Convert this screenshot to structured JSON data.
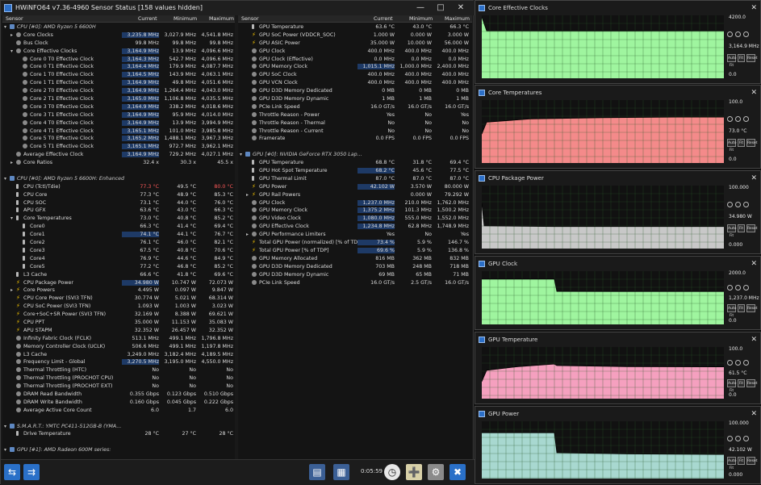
{
  "window": {
    "title": "HWiNFO64 v7.36-4960 Sensor Status [158 values hidden]"
  },
  "columns": {
    "sensor": "Sensor",
    "current": "Current",
    "minimum": "Minimum",
    "maximum": "Maximum"
  },
  "left_rows": [
    {
      "g": true,
      "n": "CPU [#0]: AMD Ryzen 5 6600H",
      "i": "chip",
      "ind": 0,
      "ar": "v"
    },
    {
      "n": "Core Clocks",
      "c": "3,235.8 MHz",
      "mn": "3,027.9 MHz",
      "mx": "4,541.8 MHz",
      "i": "circle",
      "ind": 1,
      "ar": ">",
      "hl": true
    },
    {
      "n": "Bus Clock",
      "c": "99.8 MHz",
      "mn": "99.8 MHz",
      "mx": "99.8 MHz",
      "i": "circle",
      "ind": 1
    },
    {
      "n": "Core Effective Clocks",
      "c": "3,164.9 MHz",
      "mn": "13.9 MHz",
      "mx": "4,096.6 MHz",
      "i": "circle",
      "ind": 1,
      "ar": "v",
      "hl": true
    },
    {
      "n": "Core 0 T0 Effective Clock",
      "c": "3,164.3 MHz",
      "mn": "542.7 MHz",
      "mx": "4,096.6 MHz",
      "i": "circle",
      "ind": 2,
      "hl": true
    },
    {
      "n": "Core 0 T1 Effective Clock",
      "c": "3,164.4 MHz",
      "mn": "179.9 MHz",
      "mx": "4,087.7 MHz",
      "i": "circle",
      "ind": 2,
      "hl": true
    },
    {
      "n": "Core 1 T0 Effective Clock",
      "c": "3,164.5 MHz",
      "mn": "143.9 MHz",
      "mx": "4,063.1 MHz",
      "i": "circle",
      "ind": 2,
      "hl": true
    },
    {
      "n": "Core 1 T1 Effective Clock",
      "c": "3,164.9 MHz",
      "mn": "49.8 MHz",
      "mx": "4,051.6 MHz",
      "i": "circle",
      "ind": 2,
      "hl": true
    },
    {
      "n": "Core 2 T0 Effective Clock",
      "c": "3,164.9 MHz",
      "mn": "1,264.4 MHz",
      "mx": "4,043.0 MHz",
      "i": "circle",
      "ind": 2,
      "hl": true
    },
    {
      "n": "Core 2 T1 Effective Clock",
      "c": "3,165.0 MHz",
      "mn": "1,106.8 MHz",
      "mx": "4,035.5 MHz",
      "i": "circle",
      "ind": 2,
      "hl": true
    },
    {
      "n": "Core 3 T0 Effective Clock",
      "c": "3,164.9 MHz",
      "mn": "338.2 MHz",
      "mx": "4,018.6 MHz",
      "i": "circle",
      "ind": 2,
      "hl": true
    },
    {
      "n": "Core 3 T1 Effective Clock",
      "c": "3,164.9 MHz",
      "mn": "95.9 MHz",
      "mx": "4,014.0 MHz",
      "i": "circle",
      "ind": 2,
      "hl": true
    },
    {
      "n": "Core 4 T0 Effective Clock",
      "c": "3,164.9 MHz",
      "mn": "13.9 MHz",
      "mx": "3,994.9 MHz",
      "i": "circle",
      "ind": 2,
      "hl": true
    },
    {
      "n": "Core 4 T1 Effective Clock",
      "c": "3,165.1 MHz",
      "mn": "101.0 MHz",
      "mx": "3,985.8 MHz",
      "i": "circle",
      "ind": 2,
      "hl": true
    },
    {
      "n": "Core 5 T0 Effective Clock",
      "c": "3,165.2 MHz",
      "mn": "1,488.1 MHz",
      "mx": "3,967.3 MHz",
      "i": "circle",
      "ind": 2,
      "hl": true
    },
    {
      "n": "Core 5 T1 Effective Clock",
      "c": "3,165.1 MHz",
      "mn": "972.7 MHz",
      "mx": "3,962.1 MHz",
      "i": "circle",
      "ind": 2,
      "hl": true
    },
    {
      "n": "Average Effective Clock",
      "c": "3,164.9 MHz",
      "mn": "729.2 MHz",
      "mx": "4,027.1 MHz",
      "i": "circle",
      "ind": 1,
      "hl": true
    },
    {
      "n": "Core Ratios",
      "c": "32.4 x",
      "mn": "30.3 x",
      "mx": "45.5 x",
      "i": "circle",
      "ind": 1,
      "ar": ">"
    },
    {
      "sp": true
    },
    {
      "g": true,
      "n": "CPU [#0]: AMD Ryzen 5 6600H: Enhanced",
      "i": "chip",
      "ind": 0,
      "ar": "v"
    },
    {
      "n": "CPU (Tctl/Tdie)",
      "c": "77.3 °C",
      "mn": "49.5 °C",
      "mx": "80.0 °C",
      "i": "therm",
      "ind": 1,
      "red": true
    },
    {
      "n": "CPU Core",
      "c": "77.3 °C",
      "mn": "48.9 °C",
      "mx": "85.3 °C",
      "i": "therm",
      "ind": 1
    },
    {
      "n": "CPU SOC",
      "c": "73.1 °C",
      "mn": "44.0 °C",
      "mx": "76.0 °C",
      "i": "therm",
      "ind": 1
    },
    {
      "n": "APU GFX",
      "c": "63.6 °C",
      "mn": "43.0 °C",
      "mx": "66.3 °C",
      "i": "therm",
      "ind": 1
    },
    {
      "n": "Core Temperatures",
      "c": "73.0 °C",
      "mn": "40.8 °C",
      "mx": "85.2 °C",
      "i": "therm",
      "ind": 1,
      "ar": "v"
    },
    {
      "n": "Core0",
      "c": "66.3 °C",
      "mn": "41.4 °C",
      "mx": "69.4 °C",
      "i": "therm",
      "ind": 2
    },
    {
      "n": "Core1",
      "c": "74.1 °C",
      "mn": "44.1 °C",
      "mx": "76.7 °C",
      "i": "therm",
      "ind": 2,
      "hl": true
    },
    {
      "n": "Core2",
      "c": "76.1 °C",
      "mn": "46.0 °C",
      "mx": "82.1 °C",
      "i": "therm",
      "ind": 2
    },
    {
      "n": "Core3",
      "c": "67.5 °C",
      "mn": "40.8 °C",
      "mx": "70.6 °C",
      "i": "therm",
      "ind": 2
    },
    {
      "n": "Core4",
      "c": "76.9 °C",
      "mn": "44.6 °C",
      "mx": "84.9 °C",
      "i": "therm",
      "ind": 2
    },
    {
      "n": "Core5",
      "c": "77.2 °C",
      "mn": "46.8 °C",
      "mx": "85.2 °C",
      "i": "therm",
      "ind": 2
    },
    {
      "n": "L3 Cache",
      "c": "66.6 °C",
      "mn": "41.8 °C",
      "mx": "69.6 °C",
      "i": "therm",
      "ind": 1
    },
    {
      "n": "CPU Package Power",
      "c": "34.980 W",
      "mn": "10.747 W",
      "mx": "72.073 W",
      "i": "bolt",
      "ind": 1,
      "hl": true
    },
    {
      "n": "Core Powers",
      "c": "4.495 W",
      "mn": "0.097 W",
      "mx": "9.847 W",
      "i": "bolt",
      "ind": 1,
      "ar": ">"
    },
    {
      "n": "CPU Core Power (SVI3 TFN)",
      "c": "30.774 W",
      "mn": "5.021 W",
      "mx": "68.314 W",
      "i": "bolt",
      "ind": 1
    },
    {
      "n": "CPU SoC Power (SVI3 TFN)",
      "c": "1.093 W",
      "mn": "1.003 W",
      "mx": "3.023 W",
      "i": "bolt",
      "ind": 1
    },
    {
      "n": "Core+SoC+SR Power (SVI3 TFN)",
      "c": "32.169 W",
      "mn": "8.388 W",
      "mx": "69.621 W",
      "i": "bolt",
      "ind": 1
    },
    {
      "n": "CPU PPT",
      "c": "35.000 W",
      "mn": "11.153 W",
      "mx": "35.083 W",
      "i": "bolt",
      "ind": 1
    },
    {
      "n": "APU STAPM",
      "c": "32.352 W",
      "mn": "26.457 W",
      "mx": "32.352 W",
      "i": "bolt",
      "ind": 1
    },
    {
      "n": "Infinity Fabric Clock (FCLK)",
      "c": "513.1 MHz",
      "mn": "499.1 MHz",
      "mx": "1,796.8 MHz",
      "i": "circle",
      "ind": 1
    },
    {
      "n": "Memory Controller Clock (UCLK)",
      "c": "506.6 MHz",
      "mn": "499.1 MHz",
      "mx": "1,197.8 MHz",
      "i": "circle",
      "ind": 1
    },
    {
      "n": "L3 Cache",
      "c": "3,249.0 MHz",
      "mn": "3,182.4 MHz",
      "mx": "4,189.5 MHz",
      "i": "circle",
      "ind": 1
    },
    {
      "n": "Frequency Limit - Global",
      "c": "3,270.5 MHz",
      "mn": "3,195.0 MHz",
      "mx": "4,550.0 MHz",
      "i": "circle",
      "ind": 1,
      "hl": true
    },
    {
      "n": "Thermal Throttling (HTC)",
      "c": "No",
      "mn": "No",
      "mx": "No",
      "i": "circle",
      "ind": 1
    },
    {
      "n": "Thermal Throttling (PROCHOT CPU)",
      "c": "No",
      "mn": "No",
      "mx": "No",
      "i": "circle",
      "ind": 1
    },
    {
      "n": "Thermal Throttling (PROCHOT EXT)",
      "c": "No",
      "mn": "No",
      "mx": "No",
      "i": "circle",
      "ind": 1
    },
    {
      "n": "DRAM Read Bandwidth",
      "c": "0.355 Gbps",
      "mn": "0.123 Gbps",
      "mx": "0.510 Gbps",
      "i": "circle",
      "ind": 1
    },
    {
      "n": "DRAM Write Bandwidth",
      "c": "0.160 Gbps",
      "mn": "0.045 Gbps",
      "mx": "0.222 Gbps",
      "i": "circle",
      "ind": 1
    },
    {
      "n": "Average Active Core Count",
      "c": "6.0",
      "mn": "1.7",
      "mx": "6.0",
      "i": "circle",
      "ind": 1
    },
    {
      "sp": true
    },
    {
      "g": true,
      "n": "S.M.A.R.T.: YMTC PC411-512GB-B (YMA...",
      "i": "chip",
      "ind": 0,
      "ar": "v"
    },
    {
      "n": "Drive Temperature",
      "c": "28 °C",
      "mn": "27 °C",
      "mx": "28 °C",
      "i": "therm",
      "ind": 1
    },
    {
      "sp": true
    },
    {
      "g": true,
      "n": "GPU [#1]: AMD Radeon 600M series:",
      "i": "chip",
      "ind": 0,
      "ar": "v"
    }
  ],
  "right_rows": [
    {
      "n": "GPU Temperature",
      "c": "63.6 °C",
      "mn": "43.0 °C",
      "mx": "66.3 °C",
      "i": "therm",
      "ind": 1
    },
    {
      "n": "GPU SoC Power (VDDCR_SOC)",
      "c": "1.000 W",
      "mn": "0.000 W",
      "mx": "3.000 W",
      "i": "bolt",
      "ind": 1
    },
    {
      "n": "GPU ASIC Power",
      "c": "35.000 W",
      "mn": "10.000 W",
      "mx": "56.000 W",
      "i": "bolt",
      "ind": 1
    },
    {
      "n": "GPU Clock",
      "c": "400.0 MHz",
      "mn": "400.0 MHz",
      "mx": "400.0 MHz",
      "i": "circle",
      "ind": 1
    },
    {
      "n": "GPU Clock (Effective)",
      "c": "0.0 MHz",
      "mn": "0.0 MHz",
      "mx": "0.0 MHz",
      "i": "circle",
      "ind": 1
    },
    {
      "n": "GPU Memory Clock",
      "c": "1,015.1 MHz",
      "mn": "1,000.0 MHz",
      "mx": "2,400.0 MHz",
      "i": "circle",
      "ind": 1,
      "hl": true
    },
    {
      "n": "GPU SoC Clock",
      "c": "400.0 MHz",
      "mn": "400.0 MHz",
      "mx": "400.0 MHz",
      "i": "circle",
      "ind": 1
    },
    {
      "n": "GPU VCN Clock",
      "c": "400.0 MHz",
      "mn": "400.0 MHz",
      "mx": "400.0 MHz",
      "i": "circle",
      "ind": 1
    },
    {
      "n": "GPU D3D Memory Dedicated",
      "c": "0 MB",
      "mn": "0 MB",
      "mx": "0 MB",
      "i": "circle",
      "ind": 1
    },
    {
      "n": "GPU D3D Memory Dynamic",
      "c": "1 MB",
      "mn": "1 MB",
      "mx": "1 MB",
      "i": "circle",
      "ind": 1
    },
    {
      "n": "PCIe Link Speed",
      "c": "16.0 GT/s",
      "mn": "16.0 GT/s",
      "mx": "16.0 GT/s",
      "i": "circle",
      "ind": 1
    },
    {
      "n": "Throttle Reason - Power",
      "c": "Yes",
      "mn": "No",
      "mx": "Yes",
      "i": "circle",
      "ind": 1
    },
    {
      "n": "Throttle Reason - Thermal",
      "c": "No",
      "mn": "No",
      "mx": "No",
      "i": "circle",
      "ind": 1
    },
    {
      "n": "Throttle Reason - Current",
      "c": "No",
      "mn": "No",
      "mx": "No",
      "i": "circle",
      "ind": 1
    },
    {
      "n": "Framerate",
      "c": "0.0 FPS",
      "mn": "0.0 FPS",
      "mx": "0.0 FPS",
      "i": "circle",
      "ind": 1
    },
    {
      "sp": true
    },
    {
      "g": true,
      "n": "GPU [#0]: NVIDIA GeForce RTX 3050 Lap...",
      "i": "chip",
      "ind": 0,
      "ar": "v"
    },
    {
      "n": "GPU Temperature",
      "c": "68.8 °C",
      "mn": "31.8 °C",
      "mx": "69.4 °C",
      "i": "therm",
      "ind": 1
    },
    {
      "n": "GPU Hot Spot Temperature",
      "c": "68.2 °C",
      "mn": "45.6 °C",
      "mx": "77.5 °C",
      "i": "therm",
      "ind": 1,
      "hl": true
    },
    {
      "n": "GPU Thermal Limit",
      "c": "87.0 °C",
      "mn": "87.0 °C",
      "mx": "87.0 °C",
      "i": "therm",
      "ind": 1
    },
    {
      "n": "GPU Power",
      "c": "42.102 W",
      "mn": "3.570 W",
      "mx": "80.000 W",
      "i": "bolt",
      "ind": 1,
      "hl": true
    },
    {
      "n": "GPU Rail Powers",
      "c": "",
      "mn": "0.000 W",
      "mx": "79.292 W",
      "i": "bolt",
      "ind": 1,
      "ar": ">"
    },
    {
      "n": "GPU Clock",
      "c": "1,237.0 MHz",
      "mn": "210.0 MHz",
      "mx": "1,762.0 MHz",
      "i": "circle",
      "ind": 1,
      "hl": true
    },
    {
      "n": "GPU Memory Clock",
      "c": "1,375.2 MHz",
      "mn": "101.3 MHz",
      "mx": "1,500.2 MHz",
      "i": "circle",
      "ind": 1,
      "hl": true
    },
    {
      "n": "GPU Video Clock",
      "c": "1,080.0 MHz",
      "mn": "555.0 MHz",
      "mx": "1,552.0 MHz",
      "i": "circle",
      "ind": 1,
      "hl": true
    },
    {
      "n": "GPU Effective Clock",
      "c": "1,234.8 MHz",
      "mn": "62.8 MHz",
      "mx": "1,748.9 MHz",
      "i": "circle",
      "ind": 1,
      "hl": true
    },
    {
      "n": "GPU Performance Limiters",
      "c": "Yes",
      "mn": "No",
      "mx": "Yes",
      "i": "circle",
      "ind": 1,
      "ar": ">"
    },
    {
      "n": "Total GPU Power (normalized) [% of TDP]",
      "c": "73.4 %",
      "mn": "5.9 %",
      "mx": "146.7 %",
      "i": "bolt",
      "ind": 1,
      "hl": true
    },
    {
      "n": "Total GPU Power [% of TDP]",
      "c": "69.6 %",
      "mn": "5.9 %",
      "mx": "136.8 %",
      "i": "bolt",
      "ind": 1,
      "hl": true
    },
    {
      "n": "GPU Memory Allocated",
      "c": "816 MB",
      "mn": "362 MB",
      "mx": "832 MB",
      "i": "circle",
      "ind": 1
    },
    {
      "n": "GPU D3D Memory Dedicated",
      "c": "703 MB",
      "mn": "248 MB",
      "mx": "718 MB",
      "i": "circle",
      "ind": 1
    },
    {
      "n": "GPU D3D Memory Dynamic",
      "c": "69 MB",
      "mn": "65 MB",
      "mx": "71 MB",
      "i": "circle",
      "ind": 1
    },
    {
      "n": "PCIe Link Speed",
      "c": "16.0 GT/s",
      "mn": "2.5 GT/s",
      "mx": "16.0 GT/s",
      "i": "circle",
      "ind": 1
    }
  ],
  "footer": {
    "timer": "0:05:59"
  },
  "graph_buttons": {
    "auto_fit": "Auto Fit",
    "reset": "Reset"
  },
  "graphs": [
    {
      "title": "Core Effective Clocks",
      "max_label": "4200.0",
      "cur_label": "3,164.9 MHz",
      "min_label": "0.0",
      "color": "#9ff59f",
      "vmax": 4200,
      "chart_data": {
        "type": "area",
        "y_range": [
          0,
          4200
        ],
        "points": [
          [
            0,
            4100
          ],
          [
            0.02,
            3164
          ],
          [
            0.5,
            3160
          ],
          [
            1,
            3164.9
          ]
        ]
      }
    },
    {
      "title": "Core Temperatures",
      "max_label": "100.0",
      "cur_label": "73.0 °C",
      "min_label": "0.0",
      "color": "#f48a8a",
      "vmax": 100,
      "chart_data": {
        "type": "area",
        "y_range": [
          0,
          100
        ],
        "points": [
          [
            0,
            46
          ],
          [
            0.02,
            65
          ],
          [
            0.2,
            70
          ],
          [
            0.5,
            72
          ],
          [
            0.8,
            73
          ],
          [
            1,
            73
          ]
        ]
      }
    },
    {
      "title": "CPU Package Power",
      "max_label": "100.000",
      "cur_label": "34.980 W",
      "min_label": "0.000",
      "color": "#c8c8c8",
      "vmax": 100,
      "chart_data": {
        "type": "area",
        "y_range": [
          0,
          100
        ],
        "points": [
          [
            0,
            72
          ],
          [
            0.01,
            36
          ],
          [
            0.3,
            35
          ],
          [
            0.7,
            35
          ],
          [
            1,
            34.98
          ]
        ]
      }
    },
    {
      "title": "GPU Clock",
      "max_label": "2000.0",
      "cur_label": "1,237.0 MHz",
      "min_label": "0.0",
      "color": "#9ff59f",
      "vmax": 2000,
      "chart_data": {
        "type": "area",
        "y_range": [
          0,
          2000
        ],
        "points": [
          [
            0,
            1700
          ],
          [
            0.3,
            1700
          ],
          [
            0.31,
            1240
          ],
          [
            0.6,
            1237
          ],
          [
            1,
            1237
          ]
        ]
      }
    },
    {
      "title": "GPU Temperature",
      "max_label": "100.0",
      "cur_label": "61.5 °C",
      "min_label": "0.0",
      "color": "#f5a0bf",
      "vmax": 100,
      "chart_data": {
        "type": "area",
        "y_range": [
          0,
          100
        ],
        "points": [
          [
            0,
            33
          ],
          [
            0.02,
            55
          ],
          [
            0.15,
            62
          ],
          [
            0.3,
            67
          ],
          [
            0.31,
            64
          ],
          [
            0.6,
            62
          ],
          [
            1,
            61.5
          ]
        ]
      }
    },
    {
      "title": "GPU Power",
      "max_label": "100.000",
      "cur_label": "42.102 W",
      "min_label": "0.000",
      "color": "#a8d8d0",
      "vmax": 100,
      "chart_data": {
        "type": "area",
        "y_range": [
          0,
          100
        ],
        "points": [
          [
            0,
            80
          ],
          [
            0.3,
            80
          ],
          [
            0.31,
            45
          ],
          [
            0.6,
            43
          ],
          [
            1,
            42.1
          ]
        ]
      }
    }
  ]
}
